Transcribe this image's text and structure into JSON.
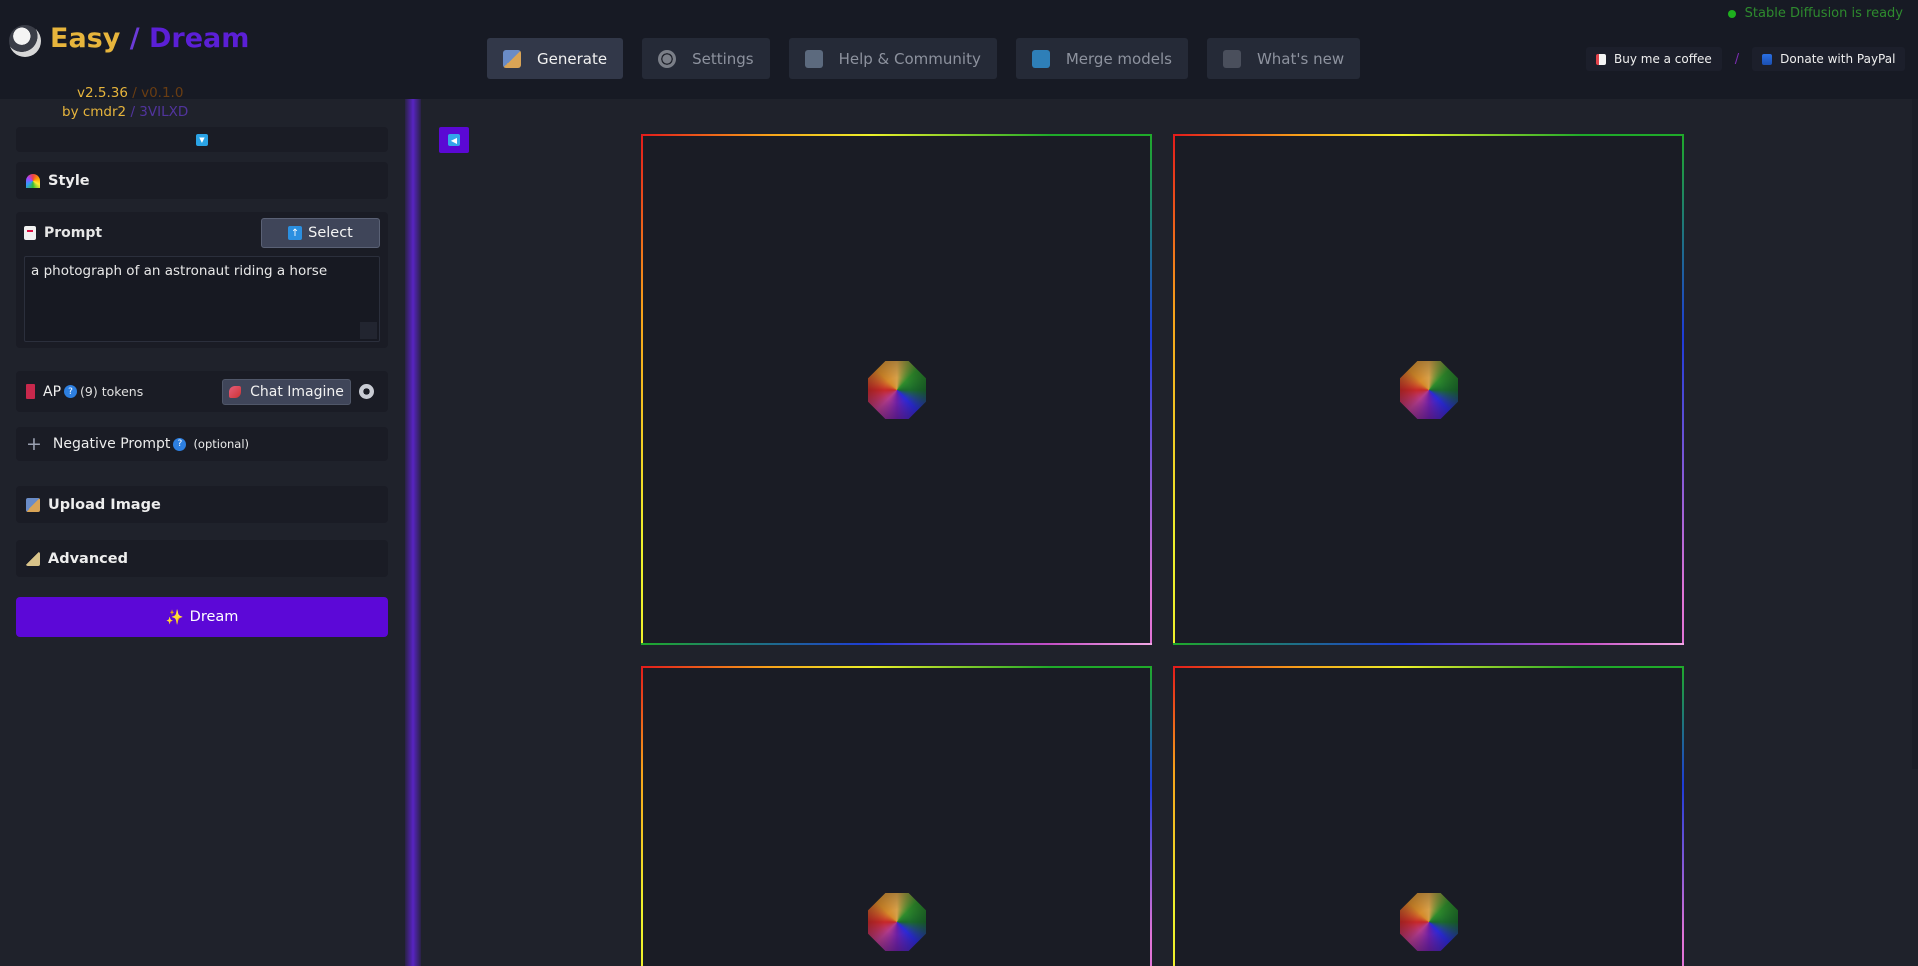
{
  "brand": {
    "title_easy": "Easy",
    "title_slash": " / ",
    "title_dream": "Dream",
    "version_main": "v2.5.36",
    "version_sub": "/ v0.1.0",
    "byline_main": "by cmdr2",
    "byline_sub": "/ 3VILXD"
  },
  "status": {
    "text": "Stable Diffusion is ready",
    "color": "#2e8b2e"
  },
  "tabs": [
    {
      "label": "Generate",
      "icon": "image-icon",
      "active": true
    },
    {
      "label": "Settings",
      "icon": "gear-icon",
      "active": false
    },
    {
      "label": "Help & Community",
      "icon": "book-icon",
      "active": false
    },
    {
      "label": "Merge models",
      "icon": "shuffle-icon",
      "active": false
    },
    {
      "label": "What's new",
      "icon": "news-icon",
      "active": false
    }
  ],
  "donate": {
    "coffee_label": "Buy me a coffee",
    "separator": "/",
    "paypal_label": "Donate with PayPal"
  },
  "sidebar": {
    "style_label": "Style",
    "prompt_label": "Prompt",
    "select_label": "Select",
    "prompt_value": "a photograph of an astronaut riding a horse",
    "ap_label": "AP",
    "token_count": "(9)",
    "token_label": "tokens",
    "chat_imagine_label": "Chat Imagine",
    "negative_label": "Negative Prompt",
    "negative_optional": "(optional)",
    "upload_label": "Upload Image",
    "advanced_label": "Advanced",
    "dream_label": "Dream",
    "dream_icon": "sparkles-icon"
  },
  "colors": {
    "accent": "#5c08d7",
    "brand_gold": "#e7b53c",
    "status_green": "#1eb01e"
  }
}
